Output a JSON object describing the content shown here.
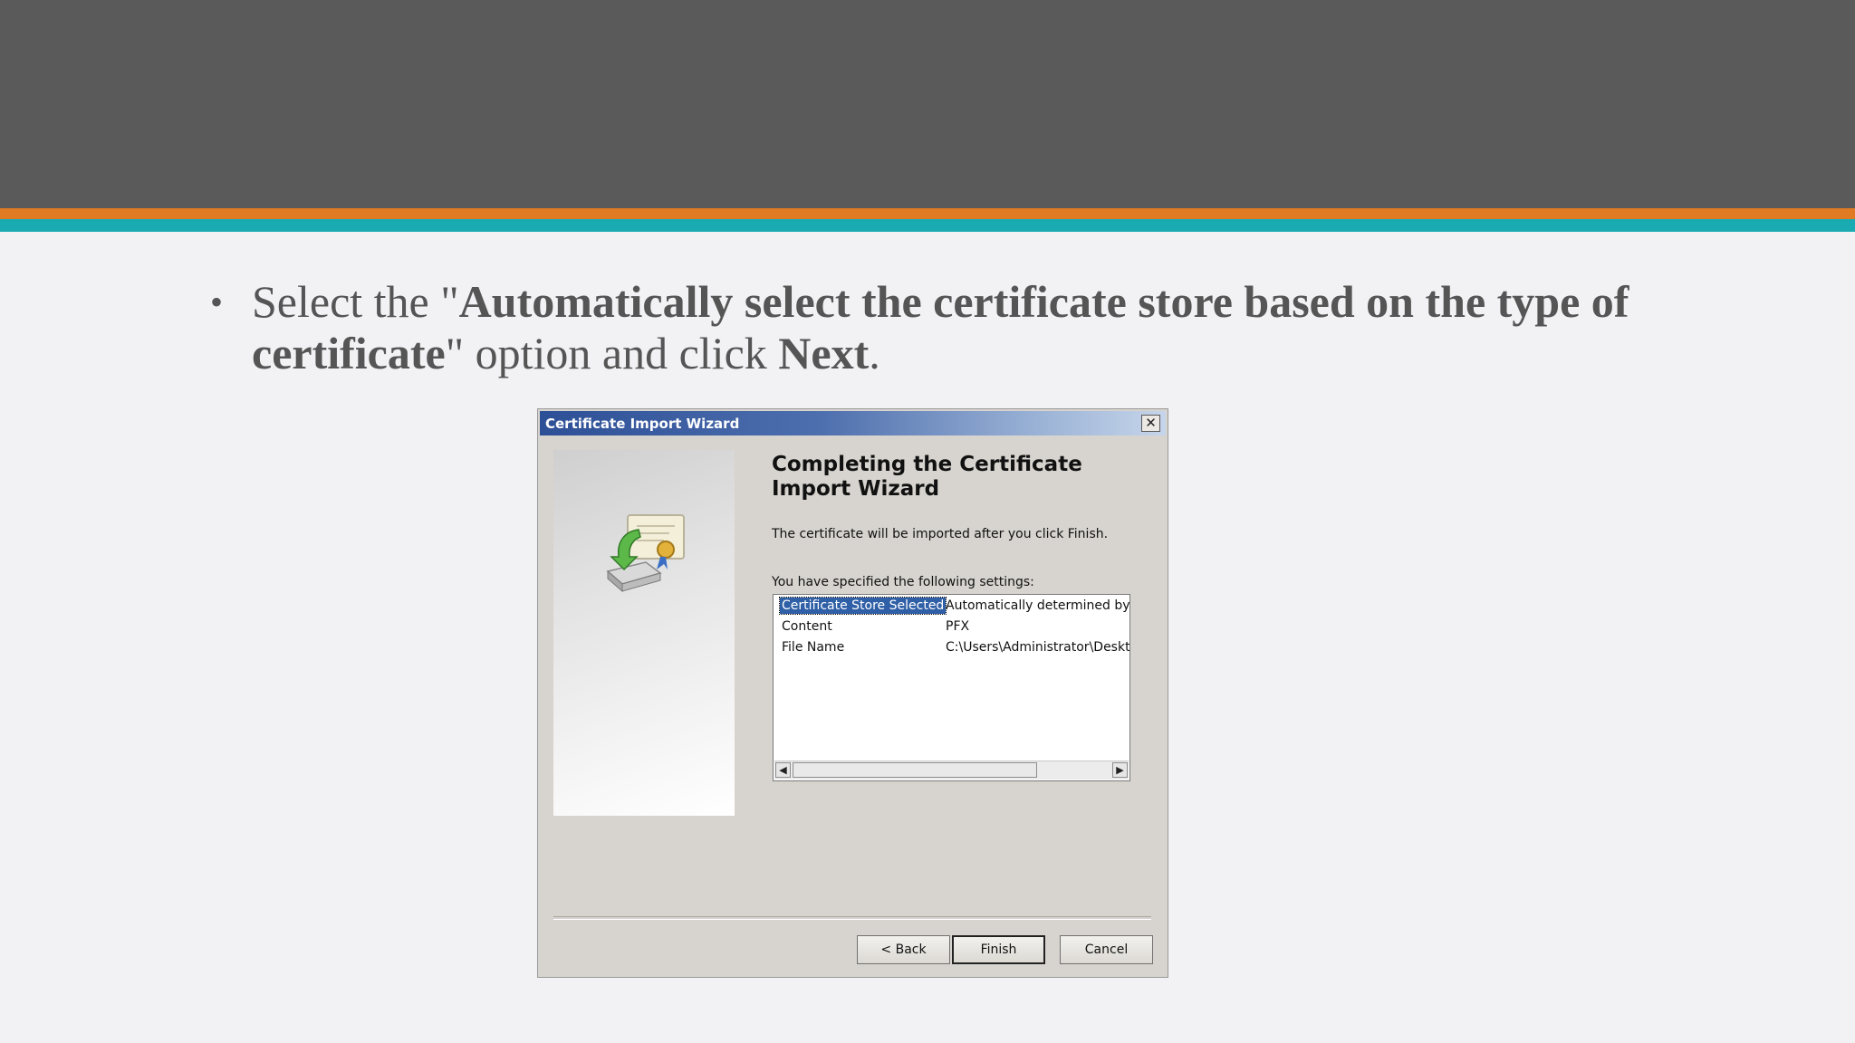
{
  "slide": {
    "bullet_symbol": "•",
    "text_1": "Select the \"",
    "bold_1": "Automatically select the certificate store based on the type of certificate",
    "text_2": "\" option and click ",
    "bold_2": "Next",
    "text_3": "."
  },
  "dialog": {
    "title": "Certificate Import Wizard",
    "close_glyph": "✕",
    "heading": "Completing the Certificate Import Wizard",
    "info_text": "The certificate will be imported after you click Finish.",
    "settings_label": "You have specified the following settings:",
    "settings": [
      {
        "key": "Certificate Store Selected",
        "value": "Automatically determined by t"
      },
      {
        "key": "Content",
        "value": "PFX"
      },
      {
        "key": "File Name",
        "value": "C:\\Users\\Administrator\\Deskto"
      }
    ],
    "scroll_left_glyph": "◀",
    "scroll_right_glyph": "▶",
    "buttons": {
      "back": "< Back",
      "finish": "Finish",
      "cancel": "Cancel"
    }
  },
  "colors": {
    "header": "#5a5a5a",
    "stripe_orange": "#e07b24",
    "stripe_teal": "#1aaab2",
    "selection": "#2f5fa6"
  },
  "icons": {
    "wizard": "certificate-import-icon"
  }
}
